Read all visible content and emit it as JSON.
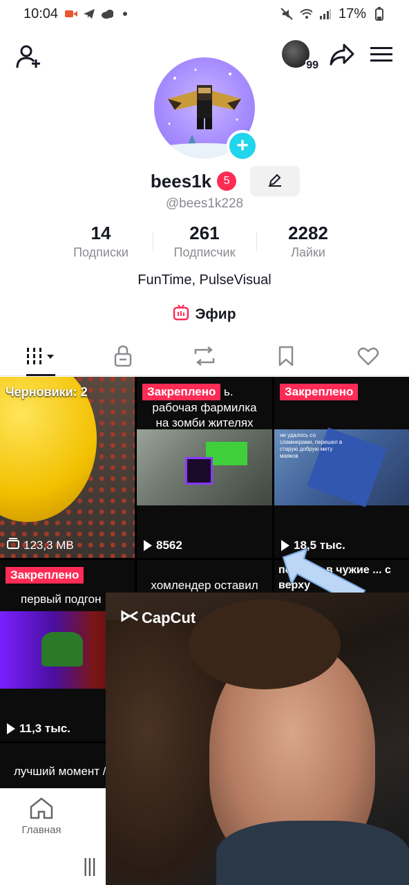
{
  "status_bar": {
    "time": "10:04",
    "battery": "17%"
  },
  "top_nav": {
    "coins": "99"
  },
  "profile": {
    "username": "bees1k",
    "badge": "5",
    "handle": "@bees1k228",
    "bio": "FunTime, PulseVisual",
    "live_label": "Эфир",
    "stats": [
      {
        "value": "14",
        "label": "Подписки"
      },
      {
        "value": "261",
        "label": "Подписчик"
      },
      {
        "value": "2282",
        "label": "Лайки"
      }
    ]
  },
  "grid": {
    "drafts": "Черновики: 2",
    "drafts_size": "123,3 MB",
    "pinned_label": "Закреплено",
    "videos": [
      {
        "caption": "рабочая фармилка на зомби жителях",
        "caption_prefix": "ь.",
        "views": "8562"
      },
      {
        "caption": "не удалось со сламнерами, перешел в старую добрую мету маяков",
        "views": "18,5 тыс."
      },
      {
        "caption": "первый подгон",
        "views": "11,3 тыс."
      },
      {
        "caption": "хомлендер оставил"
      },
      {
        "caption": "попасть в чужие ... с верху"
      },
      {
        "caption": "лучший момент /bp"
      }
    ]
  },
  "bottom_nav": {
    "home": "Главная"
  },
  "overlay": {
    "watermark": "CapCut"
  }
}
